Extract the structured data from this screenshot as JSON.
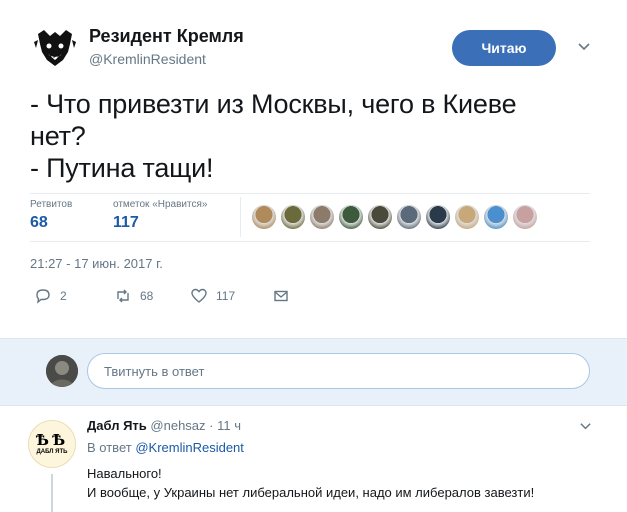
{
  "tweet": {
    "author_name": "Резидент Кремля",
    "author_handle": "@KremlinResident",
    "follow_label": "Читаю",
    "text_lines": [
      "- Что привезти из Москвы, чего в Киеве",
      "нет?",
      "- Путина тащи!"
    ],
    "stats": {
      "retweets_label": "Ретвитов",
      "retweets_value": "68",
      "likes_label": "отметок «Нравится»",
      "likes_value": "117"
    },
    "timestamp": "21:27 - 17 июн. 2017 г.",
    "actions": {
      "reply_count": "2",
      "retweet_count": "68",
      "like_count": "117"
    },
    "liker_avatars": [
      {
        "icon": "user-avatar",
        "color": "#b08a5a"
      },
      {
        "icon": "user-avatar",
        "color": "#6b6a3a"
      },
      {
        "icon": "user-avatar",
        "color": "#8c7a6a"
      },
      {
        "icon": "user-avatar",
        "color": "#3c5a3c"
      },
      {
        "icon": "user-avatar",
        "color": "#4a4a3a"
      },
      {
        "icon": "user-avatar",
        "color": "#5a6a7a"
      },
      {
        "icon": "user-avatar",
        "color": "#2a3a4a"
      },
      {
        "icon": "user-avatar",
        "color": "#c8a878"
      },
      {
        "icon": "user-avatar",
        "color": "#4a90d0"
      },
      {
        "icon": "user-avatar",
        "color": "#c9a0a0"
      }
    ]
  },
  "reply_bar": {
    "placeholder": "Твитнуть в ответ"
  },
  "reply": {
    "author_name": "Дабл Ять",
    "author_handle": "@nehsaz",
    "time": "· 11 ч",
    "avatar_glyph": "ѢѢ",
    "avatar_text": "ДАБЛ ЯТЬ",
    "in_reply_to_label": "В ответ",
    "in_reply_to_handle": "@KremlinResident",
    "body_lines": [
      "Навального!",
      "И вообще, у Украины нет либеральной идеи, надо им либералов завезти!"
    ]
  },
  "colors": {
    "accent": "#3b6fb8",
    "link": "#1b5aa8",
    "muted": "#657786",
    "reply_bar_bg": "#e8f1fa"
  }
}
